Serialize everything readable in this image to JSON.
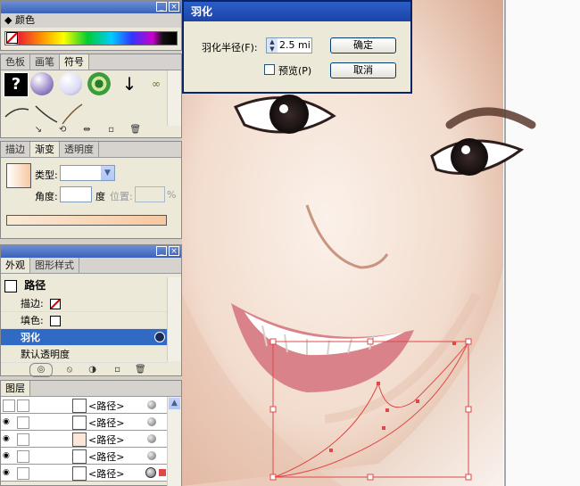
{
  "color_panel": {
    "title": "颜色"
  },
  "swatch_panel": {
    "tabs": [
      "色板",
      "画笔",
      "符号"
    ],
    "active_tab": 2
  },
  "gradient_panel": {
    "tabs": [
      "描边",
      "渐变",
      "透明度"
    ],
    "active_tab": 1,
    "type_label": "类型:",
    "type_value": "",
    "angle_label": "角度:",
    "angle_value": "",
    "angle_unit": "度",
    "position_label": "位置:",
    "position_value": "",
    "position_unit": "%"
  },
  "appearance_panel": {
    "tabs": [
      "外观",
      "图形样式"
    ],
    "active_tab": 0,
    "object_title": "路径",
    "rows": [
      {
        "label": "描边:"
      },
      {
        "label": "填色:"
      },
      {
        "label": "羽化"
      },
      {
        "label": "默认透明度"
      }
    ],
    "selected_row": 2
  },
  "layers_panel": {
    "tab": "图层",
    "items": [
      "<路径>",
      "<路径>",
      "<路径>",
      "<路径>",
      "<路径>"
    ]
  },
  "feather_dialog": {
    "title": "羽化",
    "radius_label": "羽化半径(F):",
    "radius_value": "2.5 mi",
    "preview_label": "预览(P)",
    "preview_checked": false,
    "ok_label": "确定",
    "cancel_label": "取消"
  },
  "colors": {
    "title_blue": "#3a62b9",
    "selected_row": "#316ac5",
    "path_stroke": "#e04848"
  },
  "icons": [
    "symbol-question-icon",
    "symbol-sphere-purple-icon",
    "symbol-sphere-white-icon",
    "symbol-green-ring-icon",
    "symbol-arrow-icon",
    "symbol-ornament-icon"
  ]
}
